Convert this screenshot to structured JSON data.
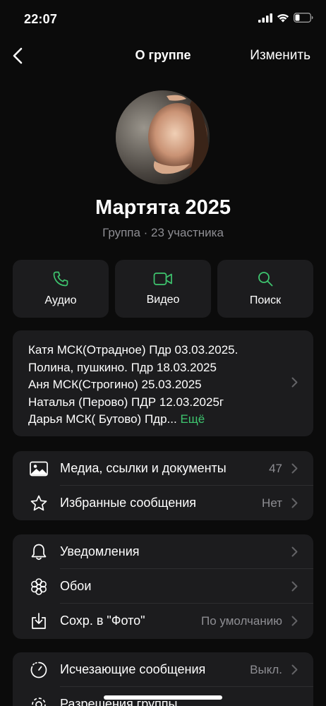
{
  "status": {
    "time": "22:07"
  },
  "nav": {
    "title": "О группе",
    "edit_label": "Изменить"
  },
  "group": {
    "name": "Мартята 2025",
    "subtitle": "Группа · 23 участника"
  },
  "actions": [
    {
      "label": "Аудио",
      "icon": "phone-icon"
    },
    {
      "label": "Видео",
      "icon": "video-icon"
    },
    {
      "label": "Поиск",
      "icon": "search-icon"
    }
  ],
  "description": {
    "lines": [
      "Катя МСК(Отрадное) Пдр 03.03.2025.",
      "Полина, пушкино. Пдр 18.03.2025",
      "Аня МСК(Строгино) 25.03.2025",
      "Наталья (Перово) ПДР 12.03.2025г",
      "Дарья МСК( Бутово) Пдр..."
    ],
    "more_label": "Ещё"
  },
  "section1": [
    {
      "label": "Медиа, ссылки и документы",
      "value": "47",
      "icon": "photo-icon"
    },
    {
      "label": "Избранные сообщения",
      "value": "Нет",
      "icon": "star-icon"
    }
  ],
  "section2": [
    {
      "label": "Уведомления",
      "value": "",
      "icon": "bell-icon"
    },
    {
      "label": "Обои",
      "value": "",
      "icon": "flower-icon"
    },
    {
      "label": "Сохр. в \"Фото\"",
      "value": "По умолчанию",
      "icon": "download-icon"
    }
  ],
  "section3": [
    {
      "label": "Исчезающие сообщения",
      "value": "Выкл.",
      "icon": "timer-icon"
    },
    {
      "label": "Разрешения группы",
      "value": "",
      "icon": "gear-icon"
    }
  ],
  "colors": {
    "background": "#0b0b0b",
    "card": "#1c1c1e",
    "accent": "#3ec56f",
    "secondary_text": "#8e8e93"
  }
}
